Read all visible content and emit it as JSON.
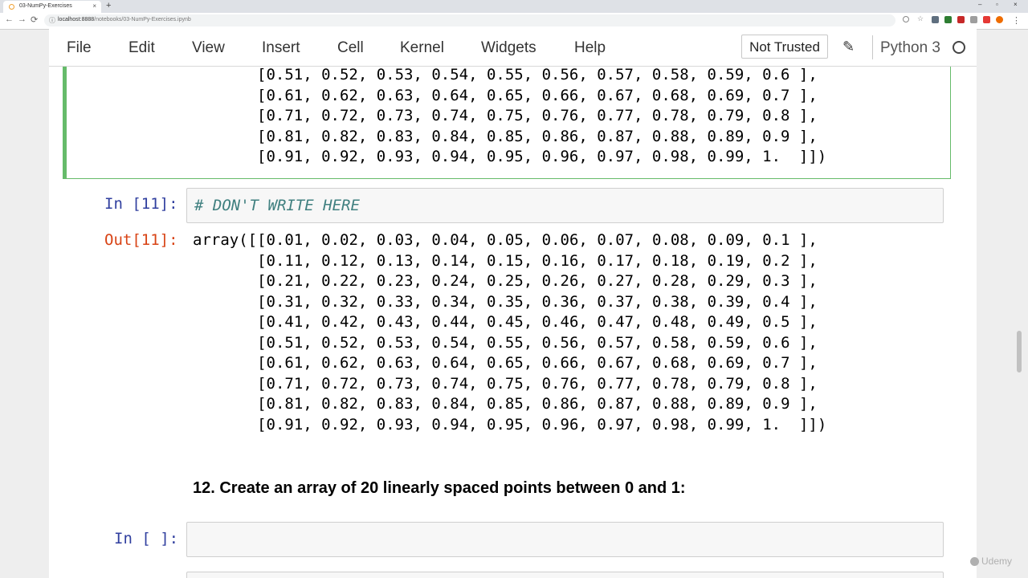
{
  "browser": {
    "tab_title": "03-NumPy-Exercises",
    "tab_close": "×",
    "new_tab": "+",
    "win_min": "–",
    "win_max": "▫",
    "win_close": "×",
    "back": "←",
    "forward": "→",
    "reload": "⟳",
    "info_icon": "ⓘ",
    "url_host": "localhost:8888",
    "url_path": "/notebooks/03-NumPy-Exercises.ipynb",
    "menu_dots": "⋮"
  },
  "toolbar": {
    "menus": [
      "File",
      "Edit",
      "View",
      "Insert",
      "Cell",
      "Kernel",
      "Widgets",
      "Help"
    ],
    "trusted_label": "Not Trusted",
    "kernel_name": "Python 3"
  },
  "cells": {
    "prev_output_lines": [
      "[0.51, 0.52, 0.53, 0.54, 0.55, 0.56, 0.57, 0.58, 0.59, 0.6 ],",
      "[0.61, 0.62, 0.63, 0.64, 0.65, 0.66, 0.67, 0.68, 0.69, 0.7 ],",
      "[0.71, 0.72, 0.73, 0.74, 0.75, 0.76, 0.77, 0.78, 0.79, 0.8 ],",
      "[0.81, 0.82, 0.83, 0.84, 0.85, 0.86, 0.87, 0.88, 0.89, 0.9 ],",
      "[0.91, 0.92, 0.93, 0.94, 0.95, 0.96, 0.97, 0.98, 0.99, 1.  ]])"
    ],
    "cell11": {
      "in_prompt": "In [11]:",
      "code": "# DON'T WRITE HERE",
      "out_prompt": "Out[11]:",
      "output_lines": [
        "array([[0.01, 0.02, 0.03, 0.04, 0.05, 0.06, 0.07, 0.08, 0.09, 0.1 ],",
        "       [0.11, 0.12, 0.13, 0.14, 0.15, 0.16, 0.17, 0.18, 0.19, 0.2 ],",
        "       [0.21, 0.22, 0.23, 0.24, 0.25, 0.26, 0.27, 0.28, 0.29, 0.3 ],",
        "       [0.31, 0.32, 0.33, 0.34, 0.35, 0.36, 0.37, 0.38, 0.39, 0.4 ],",
        "       [0.41, 0.42, 0.43, 0.44, 0.45, 0.46, 0.47, 0.48, 0.49, 0.5 ],",
        "       [0.51, 0.52, 0.53, 0.54, 0.55, 0.56, 0.57, 0.58, 0.59, 0.6 ],",
        "       [0.61, 0.62, 0.63, 0.64, 0.65, 0.66, 0.67, 0.68, 0.69, 0.7 ],",
        "       [0.71, 0.72, 0.73, 0.74, 0.75, 0.76, 0.77, 0.78, 0.79, 0.8 ],",
        "       [0.81, 0.82, 0.83, 0.84, 0.85, 0.86, 0.87, 0.88, 0.89, 0.9 ],",
        "       [0.91, 0.92, 0.93, 0.94, 0.95, 0.96, 0.97, 0.98, 0.99, 1.  ]])"
      ]
    },
    "heading12": "12. Create an array of 20 linearly spaced points between 0 and 1:",
    "empty_cell": {
      "in_prompt": "In [ ]:"
    }
  },
  "watermark": "Udemy",
  "colors": {
    "selected_border": "#66bb6a",
    "in_prompt": "#303f9f",
    "out_prompt": "#d84315",
    "comment": "#408080"
  }
}
